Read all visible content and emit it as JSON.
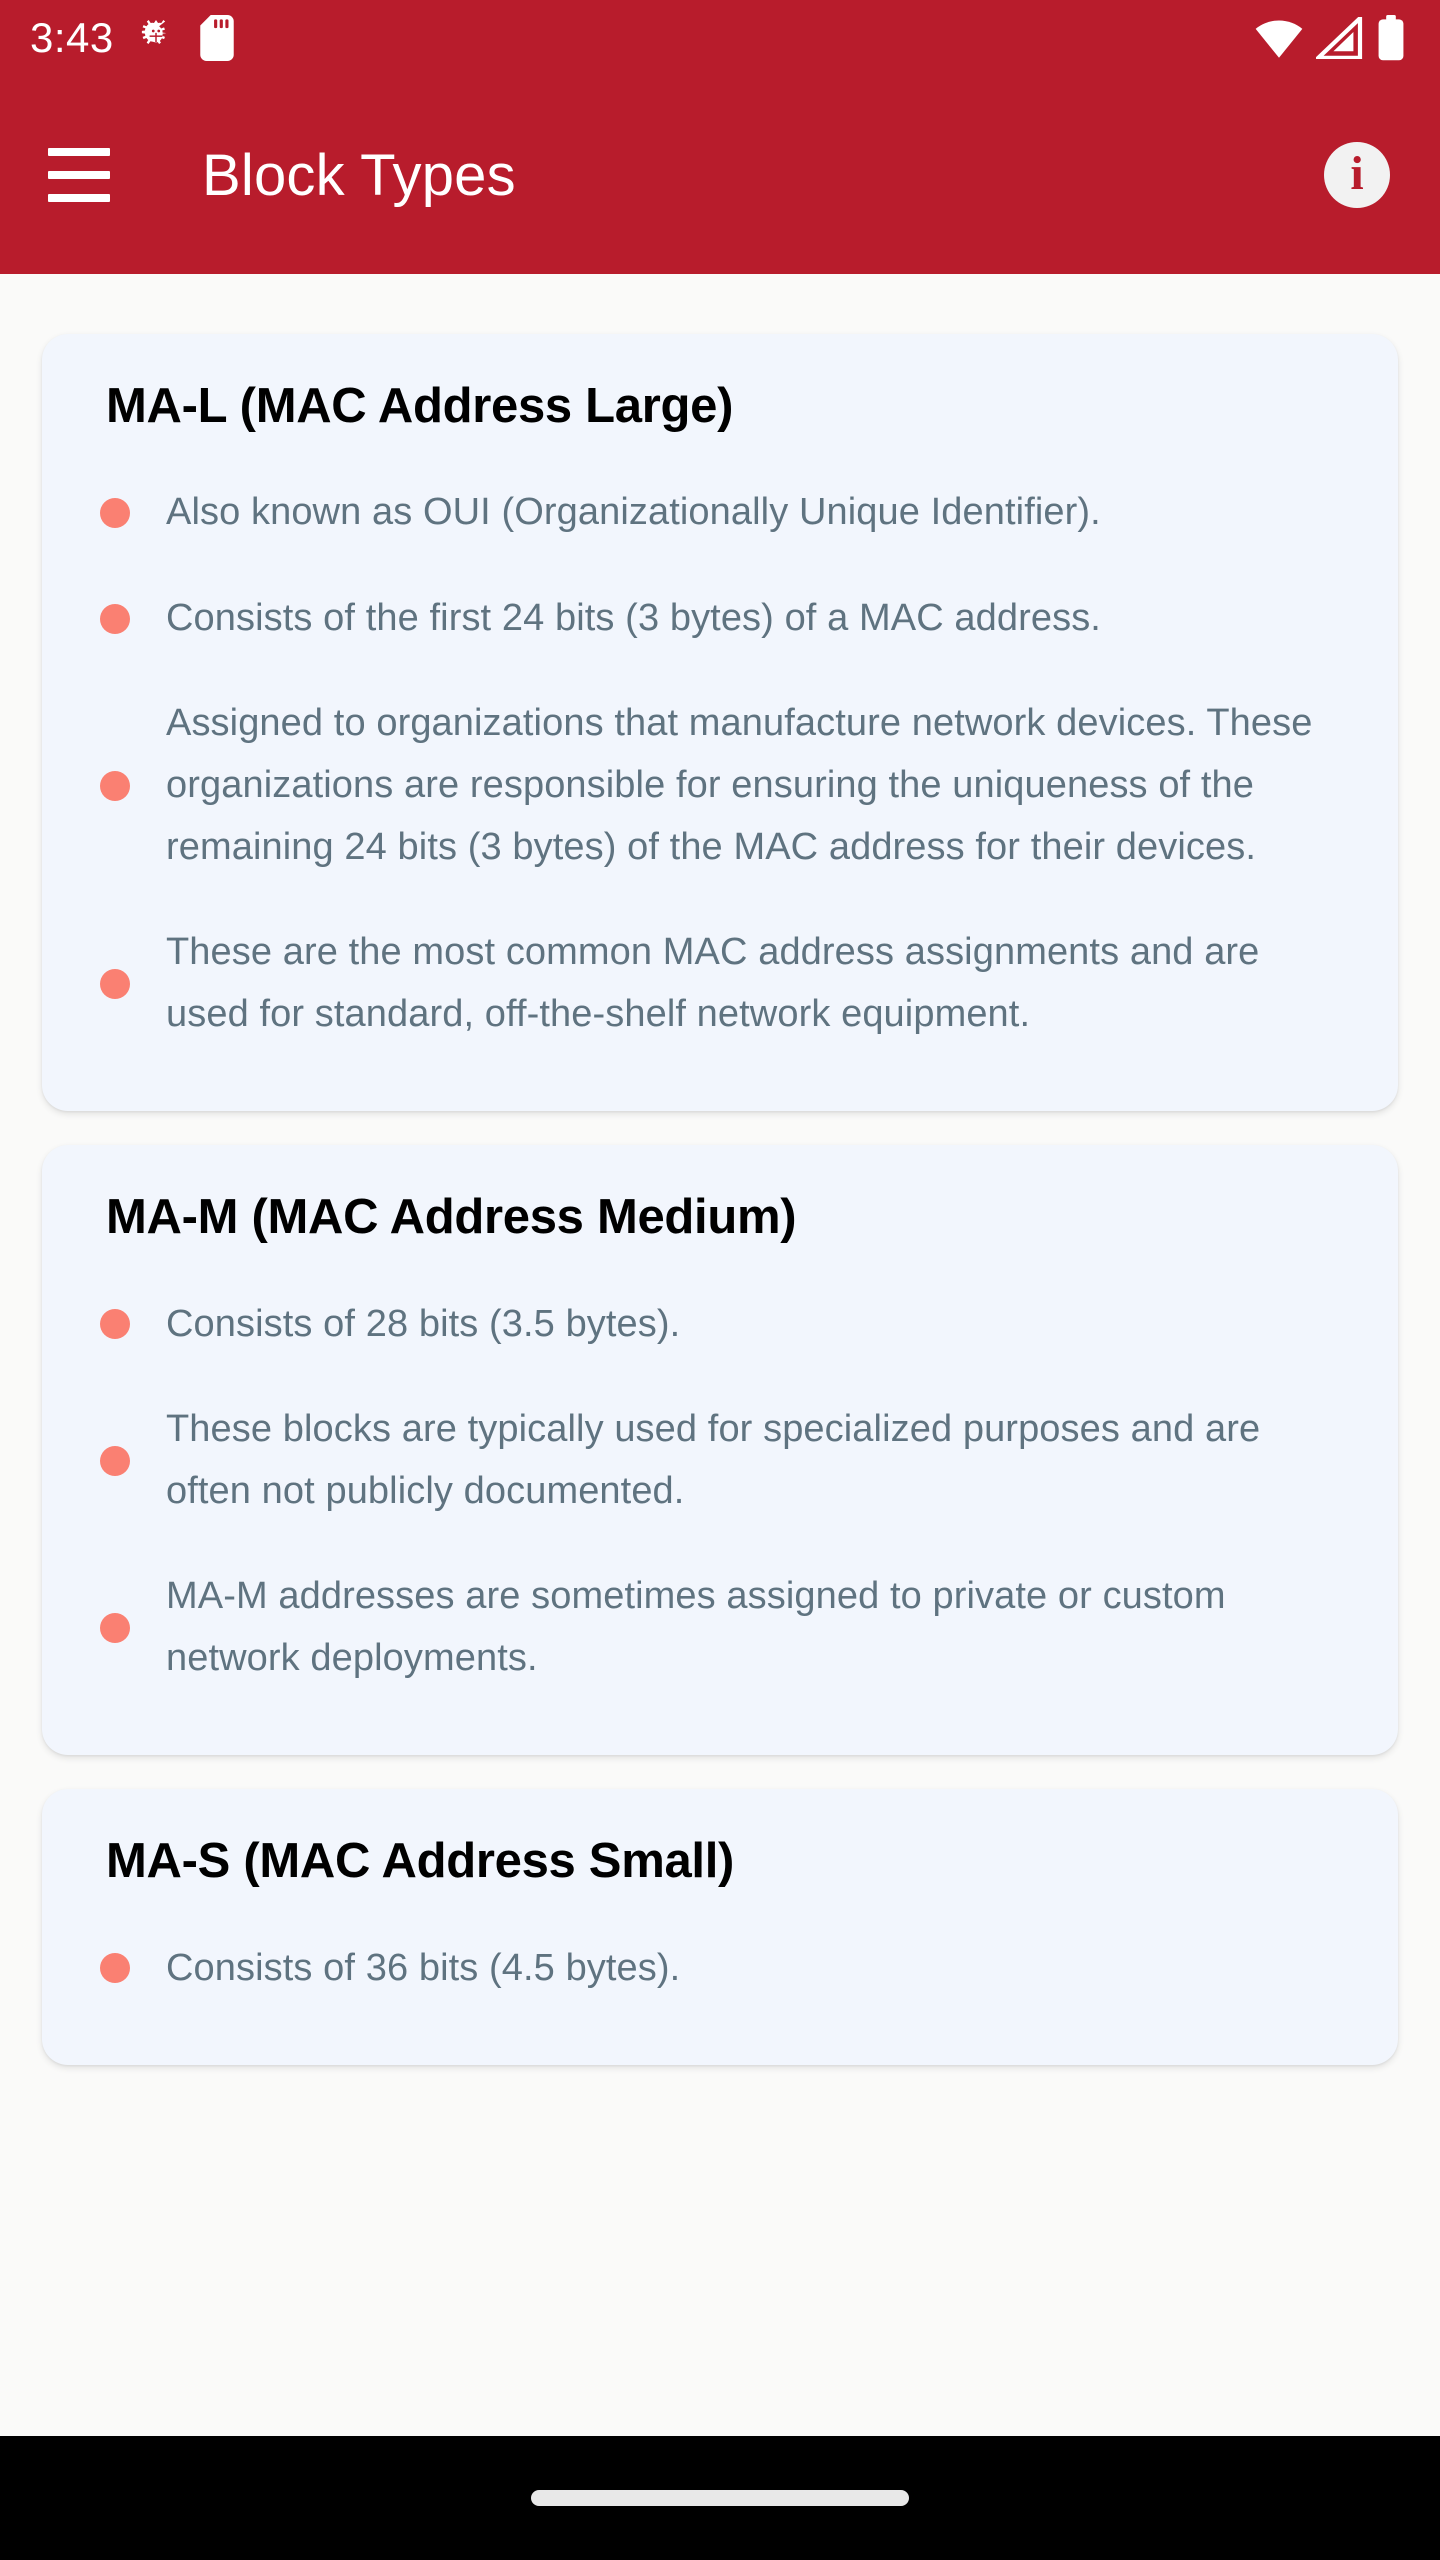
{
  "status_bar": {
    "time": "3:43",
    "icons": [
      "bug-icon",
      "sd-card-icon",
      "wifi-icon",
      "cellular-signal-icon",
      "battery-icon"
    ]
  },
  "app_bar": {
    "menu_label": "menu",
    "title": "Block Types",
    "info_glyph": "i"
  },
  "colors": {
    "app_bar": "#B81C2C",
    "page_background": "#FAFAF9",
    "card_background": "#F2F6FD",
    "bullet_dot": "#FA8072",
    "body_text": "#5F7380",
    "title_text": "#000000",
    "nav_bar": "#000000",
    "home_indicator": "#E8E8E8"
  },
  "cards": [
    {
      "title": "MA-L (MAC Address Large)",
      "bullets": [
        "Also known as OUI (Organizationally Unique Identifier).",
        "Consists of the first 24 bits (3 bytes) of a MAC address.",
        "Assigned to organizations that manufacture network devices. These organizations are responsible for ensuring the uniqueness of the remaining 24 bits (3 bytes) of the MAC address for their devices.",
        "These are the most common MAC address assignments and are used for standard, off-the-shelf network equipment."
      ]
    },
    {
      "title": "MA-M (MAC Address Medium)",
      "bullets": [
        "Consists of 28 bits (3.5 bytes).",
        "These blocks are typically used for specialized purposes and are often not publicly documented.",
        "MA-M addresses are sometimes assigned to private or custom network deployments."
      ]
    },
    {
      "title": "MA-S (MAC Address Small)",
      "bullets": [
        "Consists of 36 bits (4.5 bytes)."
      ]
    }
  ],
  "nav_bar": {
    "home_indicator_label": "home-indicator"
  }
}
